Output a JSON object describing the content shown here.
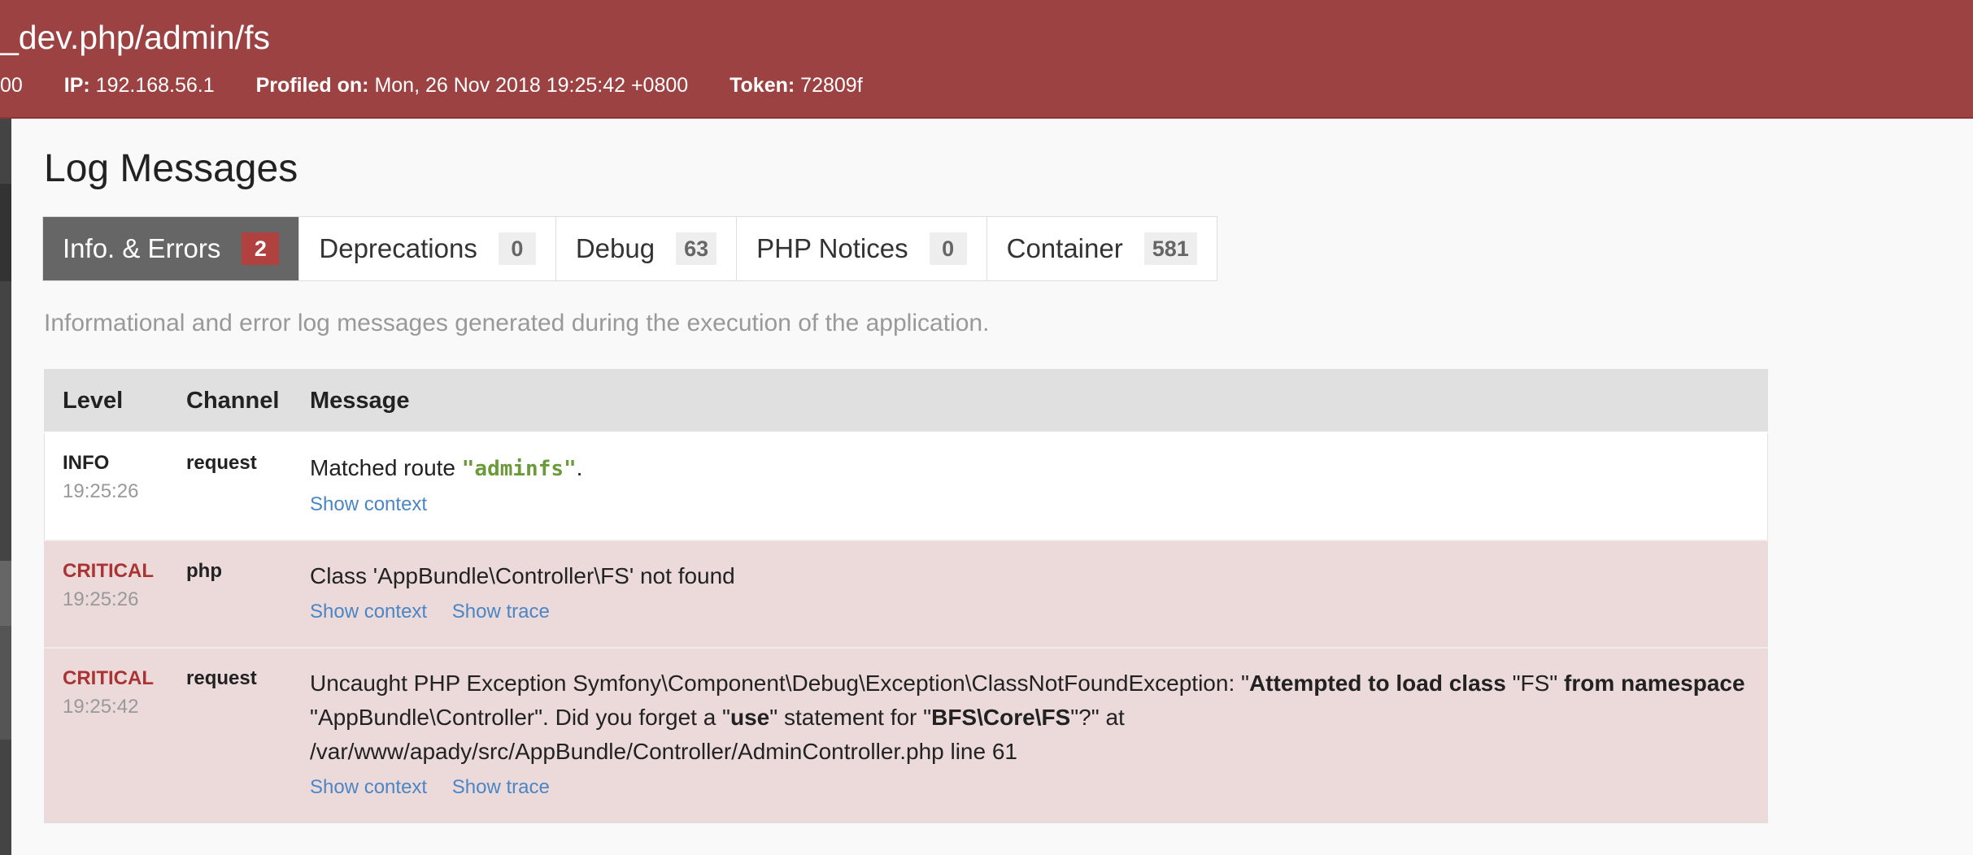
{
  "header": {
    "url": "_dev.php/admin/fs",
    "meta_prefix": "00",
    "ip_label": "IP:",
    "ip": "192.168.56.1",
    "profiled_label": "Profiled on:",
    "profiled": "Mon, 26 Nov 2018 19:25:42 +0800",
    "token_label": "Token:",
    "token": "72809f"
  },
  "page": {
    "title": "Log Messages",
    "description": "Informational and error log messages generated during the execution of the application."
  },
  "tabs": [
    {
      "label": "Info. & Errors",
      "count": "2",
      "active": true
    },
    {
      "label": "Deprecations",
      "count": "0"
    },
    {
      "label": "Debug",
      "count": "63"
    },
    {
      "label": "PHP Notices",
      "count": "0"
    },
    {
      "label": "Container",
      "count": "581"
    }
  ],
  "table": {
    "headers": {
      "level": "Level",
      "channel": "Channel",
      "message": "Message"
    },
    "rows": [
      {
        "level": "INFO",
        "time": "19:25:26",
        "channel": "request",
        "msg_pre": "Matched route ",
        "msg_route": "\"adminfs\"",
        "msg_post": ".",
        "show_context": "Show context"
      },
      {
        "level": "CRITICAL",
        "time": "19:25:26",
        "channel": "php",
        "message": "Class 'AppBundle\\Controller\\FS' not found",
        "show_context": "Show context",
        "show_trace": "Show trace"
      },
      {
        "level": "CRITICAL",
        "time": "19:25:42",
        "channel": "request",
        "m1": "Uncaught PHP Exception Symfony\\Component\\Debug\\Exception\\ClassNotFoundException: \"",
        "m2": "Attempted to load class",
        "m3": " \"FS\" ",
        "m4": "from namespace",
        "m5": " \"AppBundle\\Controller\". Did you forget a \"",
        "m6": "use",
        "m7": "\" statement for \"",
        "m8": "BFS\\Core\\FS",
        "m9": "\"?\" at",
        "m10": "/var/www/apady/src/AppBundle/Controller/AdminController.php line 61",
        "show_context": "Show context",
        "show_trace": "Show trace"
      }
    ]
  },
  "colors": {
    "header_bg": "#9c4242",
    "critical_text": "#aa3333",
    "critical_row_bg": "#ecdada",
    "link": "#4a86c5",
    "route": "#6a9a3a",
    "badge_active": "#b0413e"
  }
}
